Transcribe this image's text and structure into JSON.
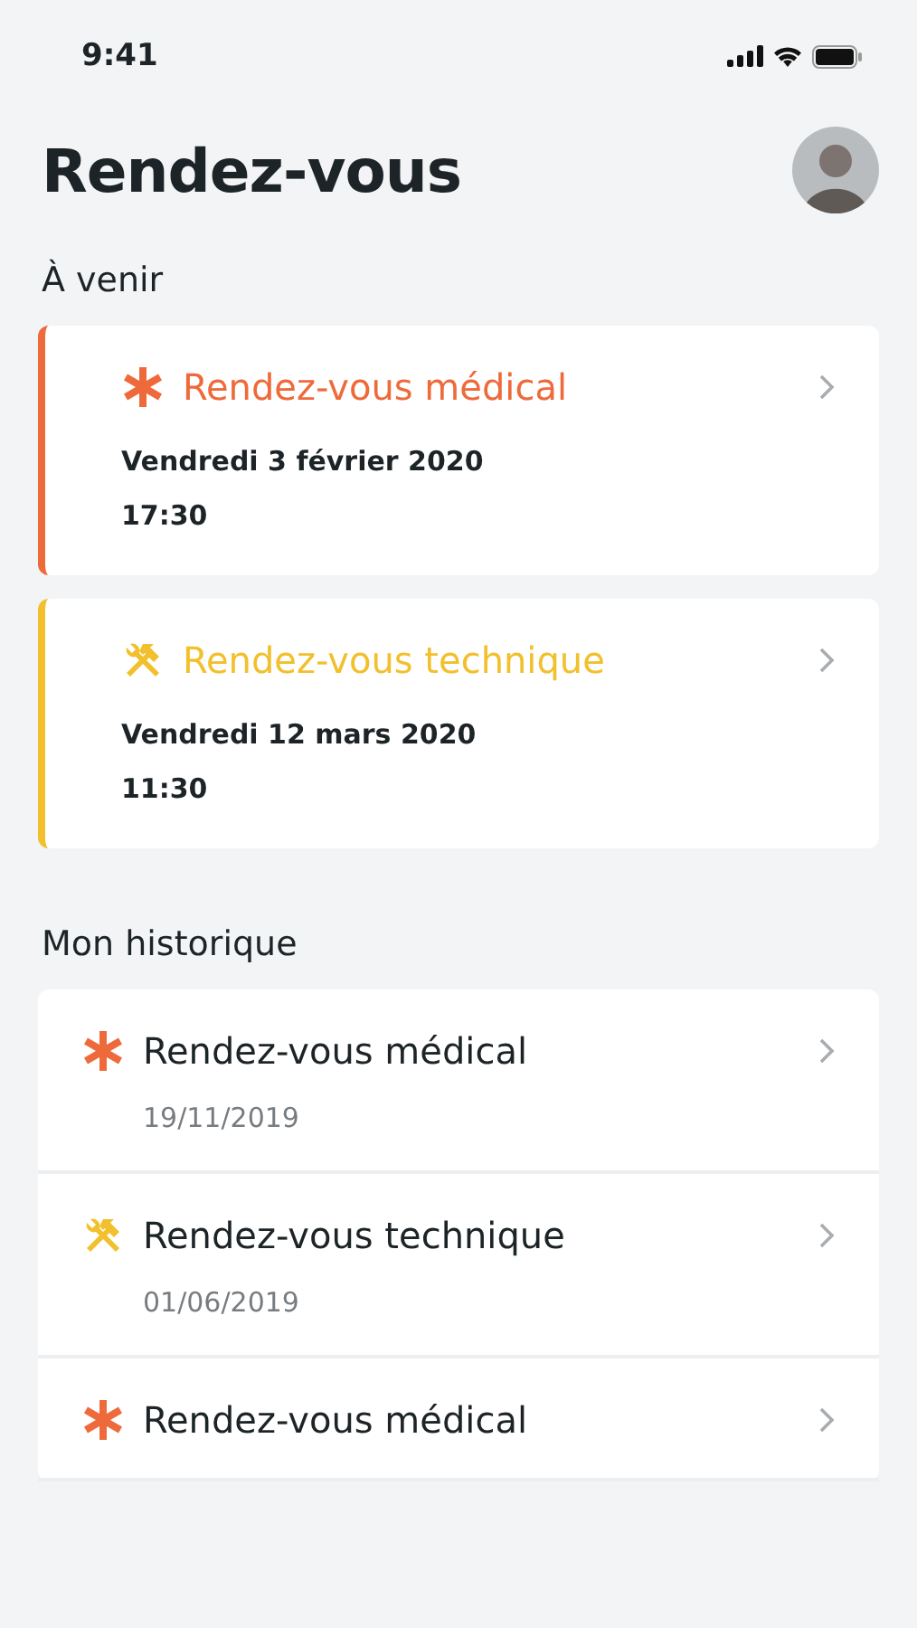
{
  "status_bar": {
    "time": "9:41"
  },
  "title": "Rendez-vous",
  "upcoming": {
    "heading": "À venir",
    "items": [
      {
        "kind": "medical",
        "color": "#ee6a3a",
        "title": "Rendez-vous médical",
        "date": "Vendredi 3 février 2020",
        "time": "17:30"
      },
      {
        "kind": "technical",
        "color": "#f2c02c",
        "title": "Rendez-vous technique",
        "date": "Vendredi 12 mars 2020",
        "time": "11:30"
      }
    ]
  },
  "history": {
    "heading": "Mon historique",
    "items": [
      {
        "kind": "medical",
        "title": "Rendez-vous médical",
        "date": "19/11/2019"
      },
      {
        "kind": "technical",
        "title": "Rendez-vous technique",
        "date": "01/06/2019"
      },
      {
        "kind": "medical",
        "title": "Rendez-vous médical"
      }
    ]
  }
}
